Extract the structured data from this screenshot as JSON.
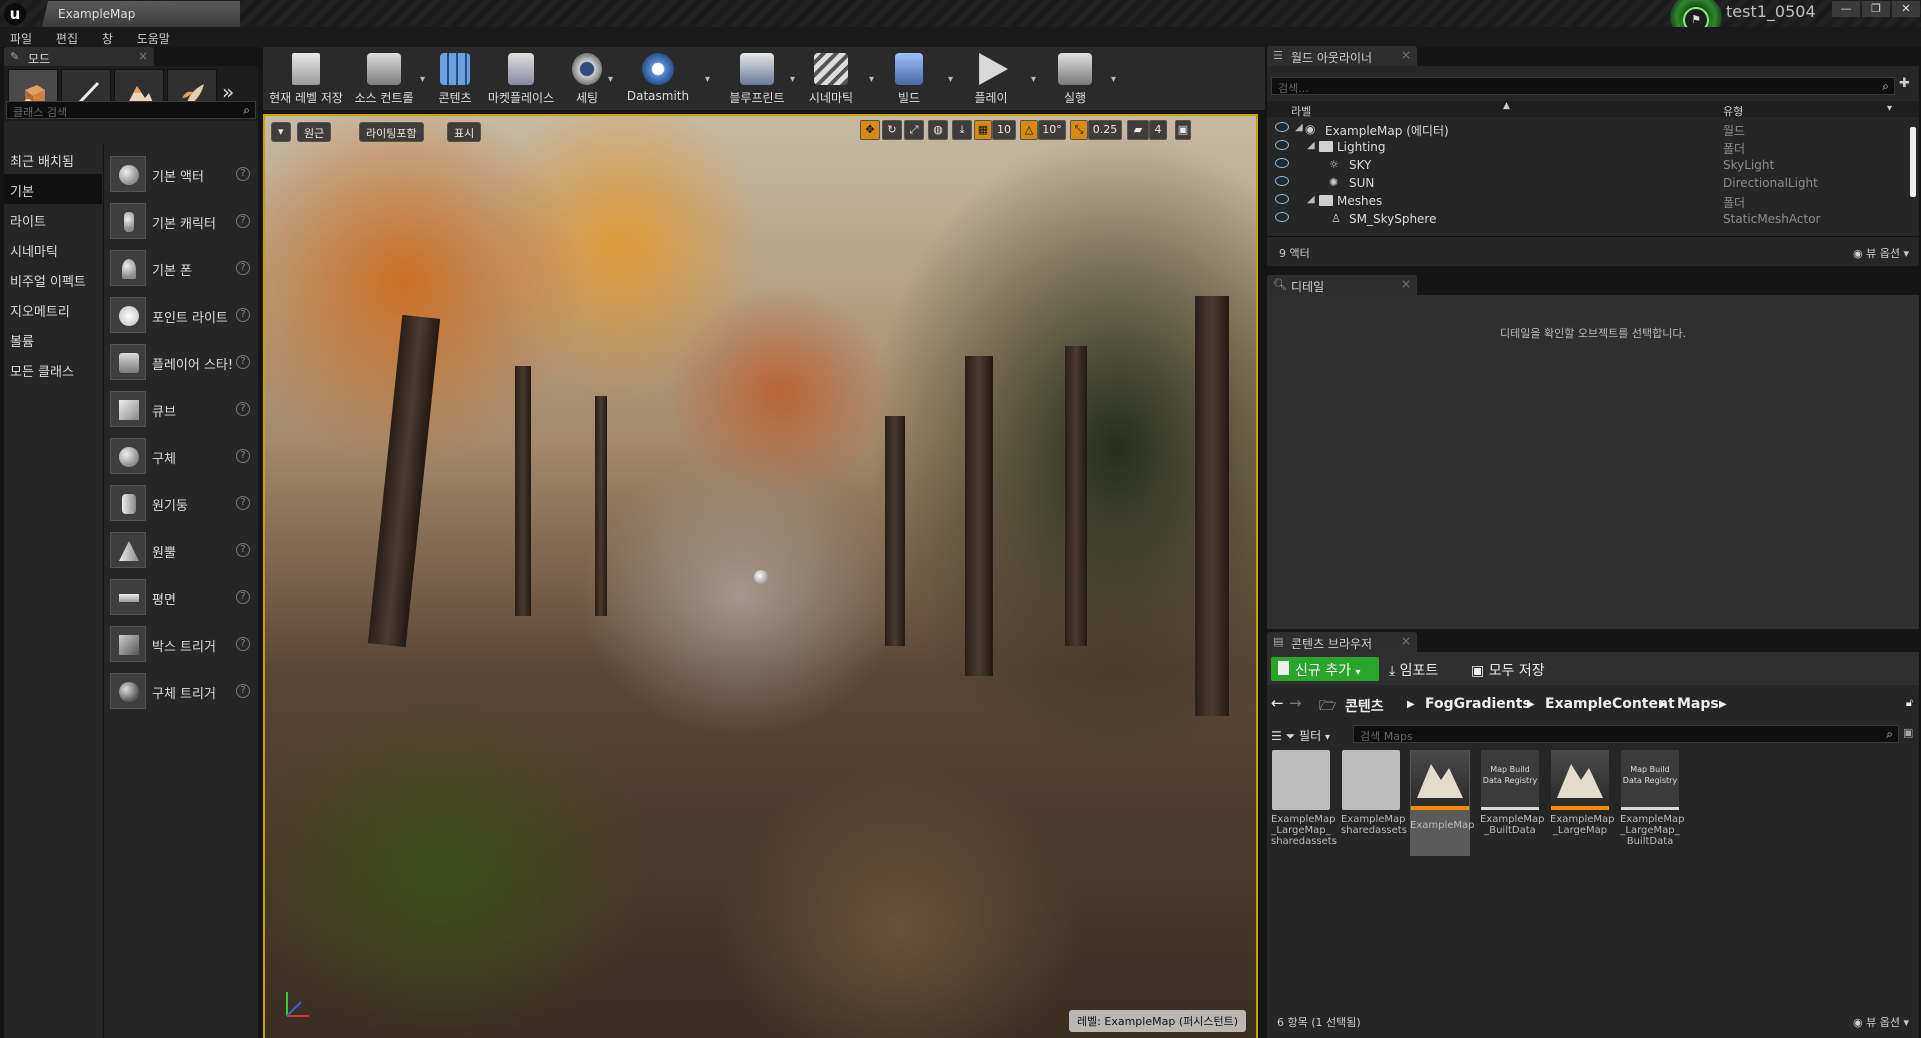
{
  "window": {
    "tab_title": "ExampleMap",
    "user_name": "test1_0504",
    "controls": [
      "—",
      "❐",
      "✕"
    ]
  },
  "menu": [
    "파일",
    "편집",
    "창",
    "도움말"
  ],
  "modes_panel": {
    "tab_label": "모드",
    "search_placeholder": "클래스 검색",
    "categories": [
      "최근 배치됨",
      "기본",
      "라이트",
      "시네마틱",
      "비주얼 이펙트",
      "지오메트리",
      "볼륨",
      "모든 클래스"
    ],
    "active_category": "기본",
    "items": [
      "기본 액터",
      "기본 캐릭터",
      "기본 폰",
      "포인트 라이트",
      "플레이어 스타!",
      "큐브",
      "구체",
      "원기둥",
      "원뿔",
      "평면",
      "박스 트리거",
      "구체 트리거"
    ]
  },
  "toolbar": {
    "buttons": [
      "현재 레벨 저장",
      "소스 컨트롤",
      "콘텐츠",
      "마켓플레이스",
      "세팅",
      "Datasmith",
      "블루프린트",
      "시네마틱",
      "빌드",
      "플레이",
      "실행"
    ]
  },
  "viewport": {
    "perspective_label": "원근",
    "lit_label": "라이팅포함",
    "show_label": "표시",
    "grid_snap": "10",
    "rotation_snap": "10°",
    "scale_snap": "0.25",
    "camera_speed": "4",
    "level_label": "레벨:  ExampleMap (퍼시스턴트)"
  },
  "outliner": {
    "tab_label": "월드 아웃라이너",
    "search_placeholder": "검색...",
    "col_label": "라벨",
    "col_type": "유형",
    "rows": [
      {
        "name": "ExampleMap (에디터)",
        "type": "월드"
      },
      {
        "name": "Lighting",
        "type": "폴더"
      },
      {
        "name": "SKY",
        "type": "SkyLight"
      },
      {
        "name": "SUN",
        "type": "DirectionalLight"
      },
      {
        "name": "Meshes",
        "type": "폴더"
      },
      {
        "name": "SM_SkySphere",
        "type": "StaticMeshActor"
      }
    ],
    "actor_count": "9 액터",
    "view_options": "뷰 옵션"
  },
  "details": {
    "tab_label": "디테일",
    "empty_message": "디테일을 확인할 오브젝트를 선택합니다."
  },
  "content_browser": {
    "tab_label": "콘텐츠 브라우저",
    "add_new": "신규 추가",
    "import": "임포트",
    "save_all": "모두 저장",
    "path": [
      "콘텐츠",
      "FogGradients",
      "ExampleContent",
      "Maps"
    ],
    "filter": "필터",
    "search_placeholder": "검색 Maps",
    "assets": [
      {
        "caption": "ExampleMap _LargeMap_ sharedassets",
        "kind": "folder"
      },
      {
        "caption": "ExampleMap sharedassets",
        "kind": "folder"
      },
      {
        "caption": "ExampleMap",
        "kind": "map"
      },
      {
        "caption": "ExampleMap _BuiltData",
        "kind": "registry",
        "thumb_text": "Map Build Data Registry"
      },
      {
        "caption": "ExampleMap _LargeMap",
        "kind": "map"
      },
      {
        "caption": "ExampleMap _LargeMap_ BuiltData",
        "kind": "registry",
        "thumb_text": "Map Build Data Registry"
      }
    ],
    "item_count": "6 항목 (1 선택됨)",
    "view_options": "뷰 옵션"
  },
  "colors": {
    "accent_orange": "#ff8a00",
    "selection_yellow": "#c9a000",
    "add_new_green": "#29a529"
  }
}
